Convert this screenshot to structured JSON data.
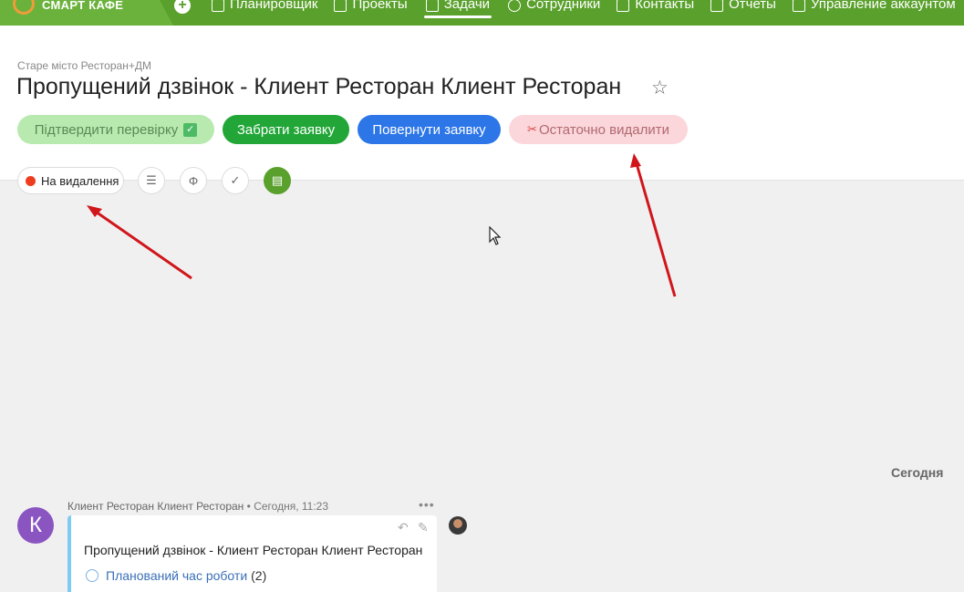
{
  "brand": {
    "name": "СМАРТ КАФЕ"
  },
  "nav": {
    "items": [
      {
        "label": "Планировщик",
        "icon": "planner-icon"
      },
      {
        "label": "Проекты",
        "icon": "projects-icon"
      },
      {
        "label": "Задачи",
        "icon": "tasks-icon",
        "active": true
      },
      {
        "label": "Сотрудники",
        "icon": "employees-icon"
      },
      {
        "label": "Контакты",
        "icon": "contacts-icon"
      },
      {
        "label": "Отчеты",
        "icon": "reports-icon"
      },
      {
        "label": "Управление аккаунтом",
        "icon": "account-icon"
      }
    ]
  },
  "task": {
    "breadcrumb": "Старе місто Ресторан+ДМ",
    "title": "Пропущений дзвінок - Клиент Ресторан Клиент Ресторан"
  },
  "actions": {
    "confirm_label": "Підтвердити перевірку",
    "take_label": "Забрати заявку",
    "return_label": "Повернути заявку",
    "delete_label": "Остаточно видалити"
  },
  "status": {
    "label": "На видалення",
    "color": "#f03c1e"
  },
  "chat": {
    "date_divider": "Сегодня",
    "messages": [
      {
        "avatar_letter": "К",
        "author": "Клиент Ресторан Клиент Ресторан",
        "separator": "•",
        "time": "Сегодня, 11:23",
        "text": "Пропущений дзвінок - Клиент Ресторан Клиент Ресторан",
        "link_label": "Планований час роботи",
        "link_count": "(2)"
      }
    ]
  },
  "colors": {
    "topbar": "#5aa02c",
    "confirm": "#b8eab0",
    "take": "#21a637",
    "return": "#2c76e8",
    "delete": "#fbd6da",
    "annotation_arrow": "#d0161b"
  }
}
